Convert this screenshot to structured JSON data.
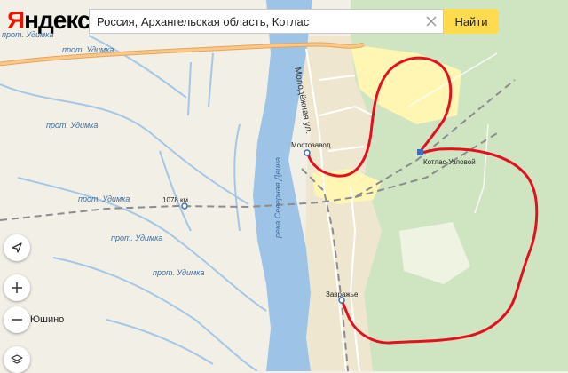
{
  "logo": {
    "first_letter": "Я",
    "rest": "ндекс"
  },
  "search": {
    "query": "Россия, Архангельская область, Котлас",
    "placeholder": "",
    "clear_icon": "close-icon",
    "find_label": "Найти"
  },
  "controls": {
    "locate_icon": "arrow-locate-icon",
    "zoom_in": "+",
    "zoom_out": "−",
    "layers_icon": "layers-icon"
  },
  "labels": {
    "prot_udimka_1": "прот. Удимка",
    "prot_udimka_2": "прот. Удимка",
    "prot_udimka_3": "прот. Удимка",
    "prot_udimka_4": "прот. Удимка",
    "prot_udimka_5": "прот. Удимка",
    "prot_udimka_6": "прот. Удимка",
    "reka": "река Северная Двина",
    "molodezhnaya": "Молодёжная ул.",
    "mostozavod": "Мостозавод",
    "kotlas_uzlovoy": "Котлас-Узловой",
    "km_1078": "1078 км",
    "zavrazhe": "Завражье",
    "yushino": "Юшино"
  },
  "colors": {
    "route": "#e3111f",
    "water": "#9dc3e6",
    "forest": "#cfe5c1",
    "sand": "#fff6b3",
    "brand_red": "#e61400",
    "button_yellow": "#ffdb4d",
    "highway": "#f0b26b"
  }
}
